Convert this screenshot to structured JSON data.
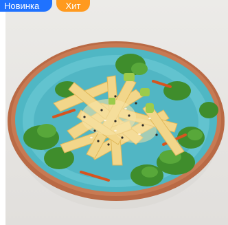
{
  "product": {
    "image_alt": "salad-bowl-photo"
  },
  "badges": [
    {
      "label": "Новинка",
      "color": "#1f72ff"
    },
    {
      "label": "Хит",
      "color": "#ff9a1f"
    }
  ]
}
